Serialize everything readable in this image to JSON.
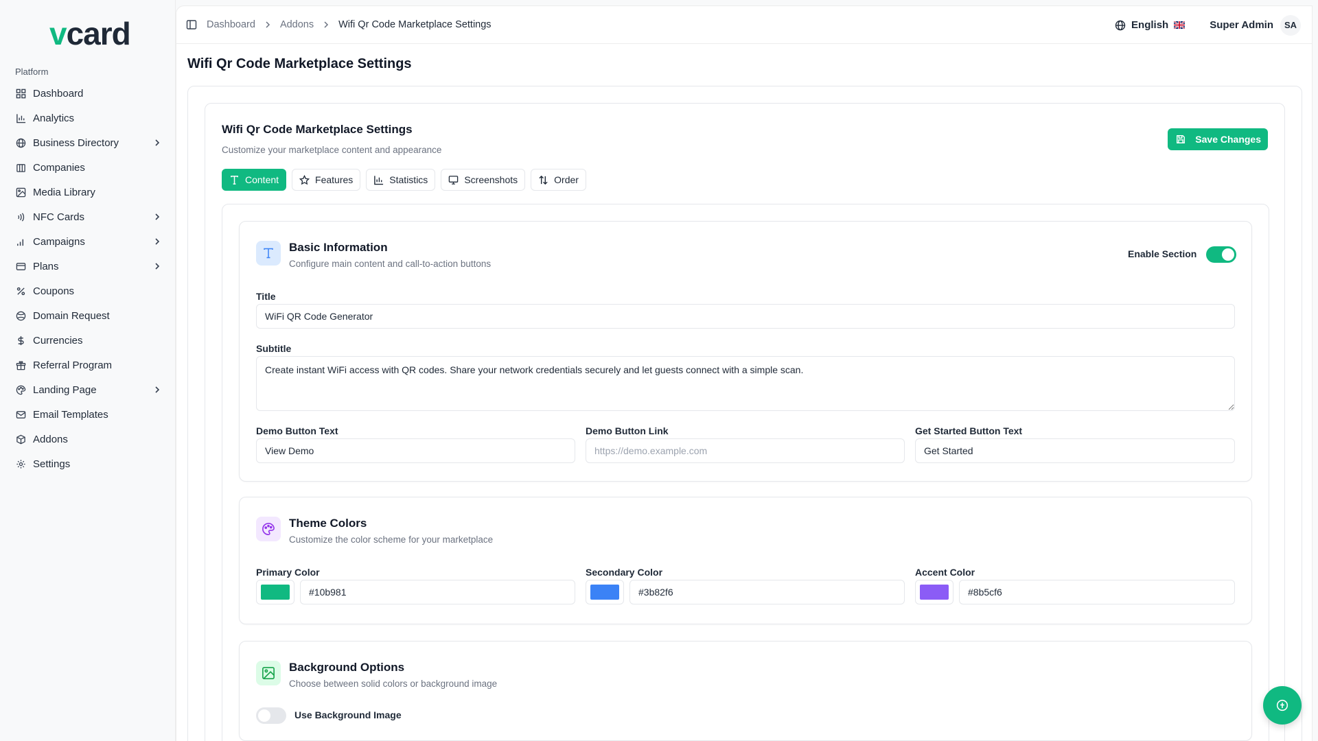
{
  "brand": {
    "logo_v": "v",
    "logo_rest": "card"
  },
  "sidebar": {
    "section_label": "Platform",
    "items": [
      {
        "label": "Dashboard",
        "icon": "grid-icon",
        "chevron": false
      },
      {
        "label": "Analytics",
        "icon": "bar-chart-icon",
        "chevron": false
      },
      {
        "label": "Business Directory",
        "icon": "globe-icon",
        "chevron": true
      },
      {
        "label": "Companies",
        "icon": "building-icon",
        "chevron": false
      },
      {
        "label": "Media Library",
        "icon": "image-icon",
        "chevron": false
      },
      {
        "label": "NFC Cards",
        "icon": "nfc-icon",
        "chevron": true
      },
      {
        "label": "Campaigns",
        "icon": "signal-icon",
        "chevron": true
      },
      {
        "label": "Plans",
        "icon": "credit-card-icon",
        "chevron": true
      },
      {
        "label": "Coupons",
        "icon": "percent-icon",
        "chevron": false
      },
      {
        "label": "Domain Request",
        "icon": "domain-icon",
        "chevron": false
      },
      {
        "label": "Currencies",
        "icon": "dollar-icon",
        "chevron": false
      },
      {
        "label": "Referral Program",
        "icon": "gift-icon",
        "chevron": false
      },
      {
        "label": "Landing Page",
        "icon": "palette-icon",
        "chevron": true
      },
      {
        "label": "Email Templates",
        "icon": "mail-icon",
        "chevron": false
      },
      {
        "label": "Addons",
        "icon": "package-icon",
        "chevron": false
      },
      {
        "label": "Settings",
        "icon": "gear-icon",
        "chevron": false
      }
    ]
  },
  "breadcrumb": {
    "items": [
      "Dashboard",
      "Addons"
    ],
    "current": "Wifi Qr Code Marketplace Settings"
  },
  "header": {
    "language": "English",
    "user_name": "Super Admin",
    "user_initials": "SA"
  },
  "page": {
    "title": "Wifi Qr Code Marketplace Settings"
  },
  "card": {
    "title": "Wifi Qr Code Marketplace Settings",
    "subtitle": "Customize your marketplace content and appearance",
    "save_label": "Save Changes"
  },
  "tabs": [
    {
      "label": "Content",
      "icon": "type-icon",
      "active": true
    },
    {
      "label": "Features",
      "icon": "star-icon",
      "active": false
    },
    {
      "label": "Statistics",
      "icon": "bar-chart-icon",
      "active": false
    },
    {
      "label": "Screenshots",
      "icon": "monitor-icon",
      "active": false
    },
    {
      "label": "Order",
      "icon": "sort-icon",
      "active": false
    }
  ],
  "basic_info": {
    "title": "Basic Information",
    "subtitle": "Configure main content and call-to-action buttons",
    "enable_label": "Enable Section",
    "enabled": true,
    "title_label": "Title",
    "title_value": "WiFi QR Code Generator",
    "subtitle_label": "Subtitle",
    "subtitle_value": "Create instant WiFi access with QR codes. Share your network credentials securely and let guests connect with a simple scan.",
    "demo_text_label": "Demo Button Text",
    "demo_text_value": "View Demo",
    "demo_link_label": "Demo Button Link",
    "demo_link_placeholder": "https://demo.example.com",
    "started_label": "Get Started Button Text",
    "started_value": "Get Started"
  },
  "theme_colors": {
    "title": "Theme Colors",
    "subtitle": "Customize the color scheme for your marketplace",
    "primary_label": "Primary Color",
    "primary_value": "#10b981",
    "secondary_label": "Secondary Color",
    "secondary_value": "#3b82f6",
    "accent_label": "Accent Color",
    "accent_value": "#8b5cf6"
  },
  "background": {
    "title": "Background Options",
    "subtitle": "Choose between solid colors or background image",
    "use_image_label": "Use Background Image",
    "use_image": false
  },
  "colors": {
    "brand": "#10b981"
  }
}
